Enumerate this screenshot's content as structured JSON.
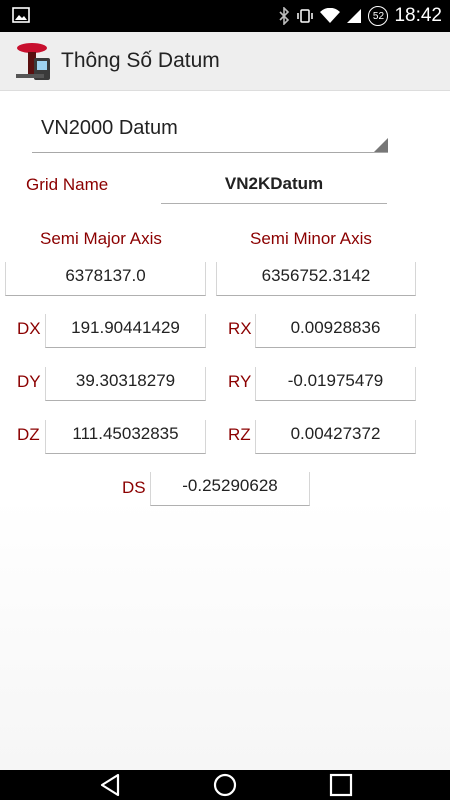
{
  "status_bar": {
    "time": "18:42",
    "battery_level": "52",
    "icons": [
      "image-notification-icon",
      "bluetooth-icon",
      "vibrate-icon",
      "wifi-icon",
      "signal-icon",
      "battery-icon"
    ]
  },
  "app_bar": {
    "title": "Thông Số Datum",
    "logo_icon": "gps-receiver-logo-icon"
  },
  "datum_selector": {
    "selected": "VN2000 Datum"
  },
  "grid": {
    "label": "Grid Name",
    "value": "VN2KDatum"
  },
  "axes": {
    "semi_major_label": "Semi Major Axis",
    "semi_major_value": "6378137.0",
    "semi_minor_label": "Semi Minor Axis",
    "semi_minor_value": "6356752.3142"
  },
  "params": {
    "dx_label": "DX",
    "dx_value": "191.90441429",
    "rx_label": "RX",
    "rx_value": "0.00928836",
    "dy_label": "DY",
    "dy_value": "39.30318279",
    "ry_label": "RY",
    "ry_value": "-0.01975479",
    "dz_label": "DZ",
    "dz_value": "111.45032835",
    "rz_label": "RZ",
    "rz_value": "0.00427372",
    "ds_label": "DS",
    "ds_value": "-0.25290628"
  },
  "nav_bar": {
    "icons": [
      "back-icon",
      "home-icon",
      "recents-icon"
    ]
  },
  "colors": {
    "label_color": "#8b0000",
    "grid_value_color": "#1a1adb",
    "app_bar_bg": "#eeeeee",
    "status_bar_bg": "#000000"
  }
}
